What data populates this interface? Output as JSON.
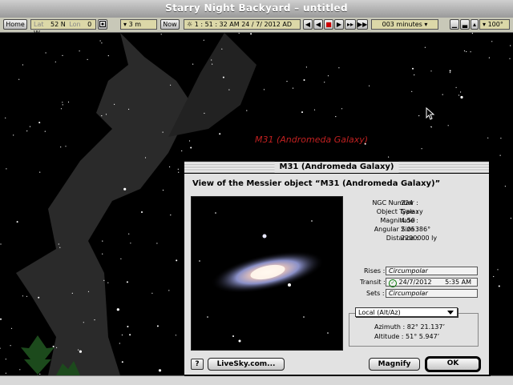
{
  "window": {
    "title": "Starry Night Backyard – untitled"
  },
  "toolbar": {
    "home": "Home",
    "lat_label": "Lat",
    "lat_value": "52 N",
    "lon_label": "Lon",
    "lon_value": "0 W",
    "elevation": "3 m",
    "now": "Now",
    "datetime": "1 : 51 : 32 AM  24 / 7/ 2012 AD",
    "step": "003 minutes",
    "zoom": "100°"
  },
  "sky": {
    "object_label": "M31 (Andromeda Galaxy)"
  },
  "dialog": {
    "title": "M31 (Andromeda Galaxy)",
    "heading": "View of the Messier object “M31 (Andromeda Galaxy)”",
    "info": [
      {
        "label": "NGC Number :",
        "value": "224"
      },
      {
        "label": "Object Type :",
        "value": "Galaxy"
      },
      {
        "label": "Magnitude :",
        "value": "4.50"
      },
      {
        "label": "Angular Size :",
        "value": "2.05386°"
      },
      {
        "label": "Distance :",
        "value": "2200000 ly"
      }
    ],
    "rises_label": "Rises :",
    "rises_value": "Circumpolar",
    "transit_label": "Transit :",
    "transit_date": "24/7/2012",
    "transit_time": "5:35 AM",
    "sets_label": "Sets :",
    "sets_value": "Circumpolar",
    "coord_system": "Local (Alt/Az)",
    "azimuth": "Azimuth : 82° 21.137’",
    "altitude": "Altitude : 51° 5.947’",
    "help": "?",
    "livesky": "LiveSky.com...",
    "magnify": "Magnify",
    "ok": "OK"
  }
}
